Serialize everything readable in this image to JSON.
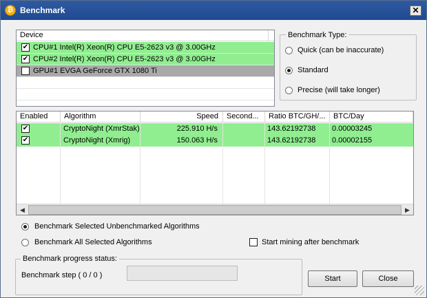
{
  "window": {
    "title": "Benchmark",
    "icon": "coin-icon",
    "close": "✕"
  },
  "devices": {
    "header": "Device",
    "items": [
      {
        "label": "CPU#1 Intel(R) Xeon(R) CPU E5-2623 v3 @ 3.00GHz",
        "checked": true,
        "color": "#90ee90"
      },
      {
        "label": "CPU#2 Intel(R) Xeon(R) CPU E5-2623 v3 @ 3.00GHz",
        "checked": true,
        "color": "#90ee90"
      },
      {
        "label": "GPU#1 EVGA GeForce GTX 1080 Ti",
        "checked": false,
        "color": "#a9a9a9"
      }
    ]
  },
  "benchmark_type": {
    "title": "Benchmark Type:",
    "options": [
      {
        "label": "Quick (can be inaccurate)",
        "selected": false
      },
      {
        "label": "Standard",
        "selected": true
      },
      {
        "label": "Precise (will take longer)",
        "selected": false
      }
    ]
  },
  "algorithms": {
    "columns": [
      "Enabled",
      "Algorithm",
      "Speed",
      "Second...",
      "Ratio BTC/GH/...",
      "BTC/Day"
    ],
    "rows": [
      {
        "enabled": true,
        "algorithm": "CryptoNight (XmrStak)",
        "speed": "225.910 H/s",
        "second": "",
        "ratio": "143.62192738",
        "btc_day": "0.00003245"
      },
      {
        "enabled": true,
        "algorithm": "CryptoNight (Xmrig)",
        "speed": "150.063 H/s",
        "second": "",
        "ratio": "143.62192738",
        "btc_day": "0.00002155"
      }
    ],
    "row_color": "#90ee90"
  },
  "options": {
    "selected_unbenchmarked": {
      "label": "Benchmark Selected Unbenchmarked Algorithms",
      "selected": true
    },
    "all_selected": {
      "label": "Benchmark All Selected Algorithms",
      "selected": false
    },
    "start_mining": {
      "label": "Start mining after benchmark",
      "checked": false
    }
  },
  "progress": {
    "title": "Benchmark progress status:",
    "step": "Benchmark step ( 0 / 0 )",
    "value": 0
  },
  "buttons": {
    "start": "Start",
    "close": "Close"
  }
}
